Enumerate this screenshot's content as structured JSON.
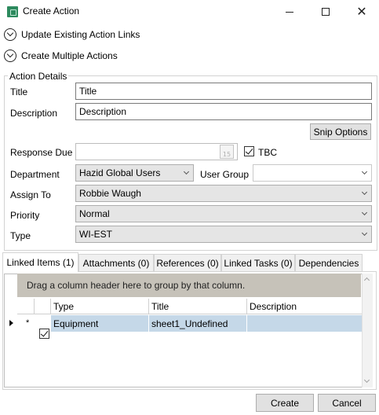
{
  "window": {
    "title": "Create Action",
    "icon": "app-icon",
    "controls": {
      "minimize": "minimize-icon",
      "maximize": "maximize-icon",
      "close": "close-icon"
    }
  },
  "expanders": [
    {
      "label": "Update Existing Action Links",
      "icon": "chevron-down-circle-icon"
    },
    {
      "label": "Create Multiple Actions",
      "icon": "chevron-down-circle-icon"
    }
  ],
  "action_details": {
    "group_label": "Action Details",
    "title_label": "Title",
    "title_value": "Title",
    "description_label": "Description",
    "description_value": "Description",
    "snip_options_label": "Snip Options",
    "response_due_label": "Response Due",
    "response_due_value": "",
    "calendar_day": "15",
    "tbc_label": "TBC",
    "tbc_checked": true,
    "department_label": "Department",
    "department_value": "Hazid Global Users",
    "user_group_label": "User Group",
    "user_group_value": "",
    "assign_to_label": "Assign To",
    "assign_to_value": "Robbie Waugh",
    "priority_label": "Priority",
    "priority_value": "Normal",
    "type_label": "Type",
    "type_value": "WI-EST"
  },
  "tabs": [
    {
      "label": "Linked Items (1)",
      "active": true
    },
    {
      "label": "Attachments (0)",
      "active": false
    },
    {
      "label": "References (0)",
      "active": false
    },
    {
      "label": "Linked Tasks (0)",
      "active": false
    },
    {
      "label": "Dependencies",
      "active": false
    }
  ],
  "grid": {
    "group_panel_text": "Drag a column header here to group by that column.",
    "columns": [
      "Type",
      "Title",
      "Description"
    ],
    "rows": [
      {
        "marker": "*",
        "checked": true,
        "type": "Equipment",
        "title": "sheet1_Undefined",
        "description": ""
      }
    ]
  },
  "footer": {
    "create_label": "Create",
    "cancel_label": "Cancel"
  },
  "colors": {
    "selected_row": "#c5d8e8",
    "group_panel": "#c6c2b9",
    "app_icon": "#2d8a5e"
  }
}
